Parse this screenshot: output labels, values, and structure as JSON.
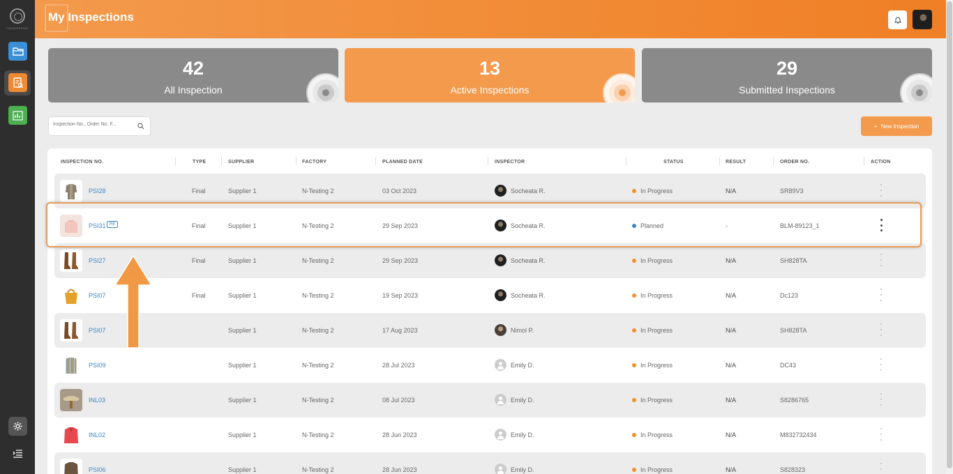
{
  "brand": {
    "logo_text": "FINGERPRINT"
  },
  "header": {
    "title": "My Inspections"
  },
  "colors": {
    "accent": "#f07f25",
    "link": "#3a86c8",
    "status_in_progress": "#f0902d",
    "status_planned": "#3a86c8"
  },
  "stats": [
    {
      "value": "42",
      "label": "All Inspection"
    },
    {
      "value": "13",
      "label": "Active Inspections"
    },
    {
      "value": "29",
      "label": "Submitted Inspections"
    }
  ],
  "search": {
    "placeholder": "Inspection No., Order No. F..."
  },
  "new_button": {
    "label": "New Inspection"
  },
  "table": {
    "columns": [
      "INSPECTION NO.",
      "TYPE",
      "SUPPLIER",
      "FACTORY",
      "PLANNED DATE",
      "INSPECTOR",
      "STATUS",
      "RESULT",
      "ORDER NO.",
      "ACTION"
    ],
    "rows": [
      {
        "no": "PSI28",
        "badge": "",
        "type": "Final",
        "supplier": "Supplier 1",
        "factory": "N-Testing 2",
        "date": "03 Oct 2023",
        "inspector": "Socheata R.",
        "status": "In Progress",
        "result": "N/A",
        "order": "SR89V3"
      },
      {
        "no": "PSI31",
        "badge": "RE",
        "type": "Final",
        "supplier": "Supplier 1",
        "factory": "N-Testing 2",
        "date": "29 Sep 2023",
        "inspector": "Socheata R.",
        "status": "Planned",
        "result": "-",
        "order": "BLM-89123_1"
      },
      {
        "no": "PSI27",
        "badge": "",
        "type": "Final",
        "supplier": "Supplier 1",
        "factory": "N-Testing 2",
        "date": "29 Sep 2023",
        "inspector": "Socheata R.",
        "status": "In Progress",
        "result": "N/A",
        "order": "SH828TA"
      },
      {
        "no": "PSI07",
        "badge": "",
        "type": "Final",
        "supplier": "Supplier 1",
        "factory": "N-Testing 2",
        "date": "19 Sep 2023",
        "inspector": "Socheata R.",
        "status": "In Progress",
        "result": "N/A",
        "order": "Dc123"
      },
      {
        "no": "PSI07",
        "badge": "",
        "type": "",
        "supplier": "Supplier 1",
        "factory": "N-Testing 2",
        "date": "17 Aug 2023",
        "inspector": "Nimol P.",
        "status": "In Progress",
        "result": "N/A",
        "order": "SH828TA"
      },
      {
        "no": "PSI09",
        "badge": "",
        "type": "",
        "supplier": "Supplier 1",
        "factory": "N-Testing 2",
        "date": "28 Jul 2023",
        "inspector": "Emily D.",
        "status": "In Progress",
        "result": "N/A",
        "order": "DC43"
      },
      {
        "no": "INL03",
        "badge": "",
        "type": "",
        "supplier": "Supplier 1",
        "factory": "N-Testing 2",
        "date": "08 Jul 2023",
        "inspector": "Emily D.",
        "status": "In Progress",
        "result": "N/A",
        "order": "S8286765"
      },
      {
        "no": "INL02",
        "badge": "",
        "type": "",
        "supplier": "Supplier 1",
        "factory": "N-Testing 2",
        "date": "28 Jun 2023",
        "inspector": "Emily D.",
        "status": "In Progress",
        "result": "N/A",
        "order": "M832732434"
      },
      {
        "no": "PSI06",
        "badge": "",
        "type": "",
        "supplier": "Supplier 1",
        "factory": "N-Testing 2",
        "date": "28 Jun 2023",
        "inspector": "Emily D.",
        "status": "In Progress",
        "result": "N/A",
        "order": "S828323"
      }
    ]
  }
}
